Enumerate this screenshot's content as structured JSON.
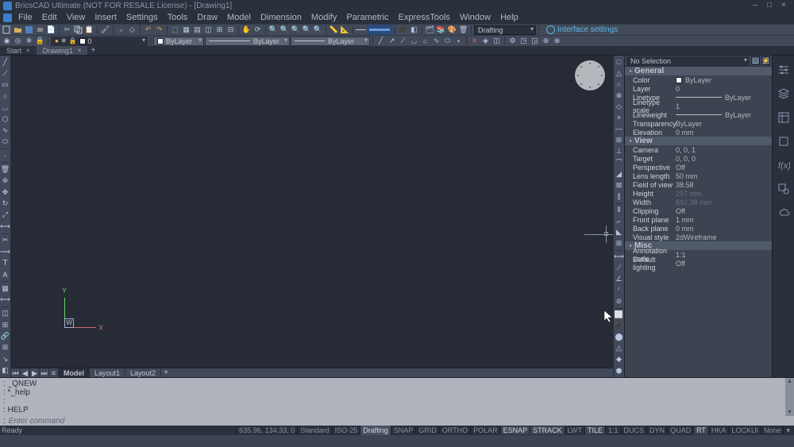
{
  "title": "BricsCAD Ultimate (NOT FOR RESALE License) - [Drawing1]",
  "menus": [
    "File",
    "Edit",
    "View",
    "Insert",
    "Settings",
    "Tools",
    "Draw",
    "Model",
    "Dimension",
    "Modify",
    "Parametric",
    "ExpressTools",
    "Window",
    "Help"
  ],
  "toolbar2": {
    "layer_value": "0",
    "workspace": "Drafting",
    "if_settings": "Interface settings",
    "bylayer": "ByLayer"
  },
  "tabs": {
    "start": "Start",
    "drawing": "Drawing1"
  },
  "ucs": {
    "w": "W",
    "x": "X",
    "y": "Y"
  },
  "layout_tabs": {
    "model": "Model",
    "l1": "Layout1",
    "l2": "Layout2"
  },
  "props": {
    "no_selection": "No Selection",
    "groups": {
      "general": "General",
      "view": "View",
      "misc": "Misc"
    },
    "general": {
      "color_k": "Color",
      "color_v": "ByLayer",
      "layer_k": "Layer",
      "layer_v": "0",
      "linetype_k": "Linetype",
      "linetype_v": "ByLayer",
      "linetype_scale_k": "Linetype scale",
      "linetype_scale_v": "1",
      "lineweight_k": "Lineweight",
      "lineweight_v": "ByLayer",
      "transparency_k": "Transparency",
      "transparency_v": "ByLayer",
      "elevation_k": "Elevation",
      "elevation_v": "0 mm"
    },
    "view": {
      "camera_k": "Camera",
      "camera_v": "0, 0, 1",
      "target_k": "Target",
      "target_v": "0, 0, 0",
      "perspective_k": "Perspective",
      "perspective_v": "Off",
      "lens_k": "Lens length",
      "lens_v": "50 mm",
      "fov_k": "Field of view",
      "fov_v": "38.58",
      "height_k": "Height",
      "height_v": "297 mm",
      "width_k": "Width",
      "width_v": "692.38 mm",
      "clipping_k": "Clipping",
      "clipping_v": "Off",
      "front_k": "Front plane",
      "front_v": "1 mm",
      "back_k": "Back plane",
      "back_v": "0 mm",
      "visual_k": "Visual style",
      "visual_v": "2dWireframe"
    },
    "misc": {
      "anno_k": "Annotation scale",
      "anno_v": "1:1",
      "light_k": "Default lighting",
      "light_v": "Off"
    }
  },
  "cmd_history": [
    ": _QNEW",
    ": *_help",
    ":",
    ": HELP"
  ],
  "cmd_prompt": ":",
  "cmd_hint": "Enter command",
  "status": {
    "ready": "Ready",
    "coords": "635.96, 134.33, 0",
    "std": "Standard",
    "iso": "ISO-25",
    "drafting": "Drafting",
    "items": [
      "SNAP",
      "GRID",
      "ORTHO",
      "POLAR",
      "ESNAP",
      "STRACK",
      "LWT",
      "TILE",
      "1:1",
      "DUCS",
      "DYN",
      "QUAD",
      "RT",
      "HKA",
      "LOCKUI"
    ],
    "on": {
      "ESNAP": true,
      "STRACK": true,
      "TILE": true,
      "RT": true
    },
    "none": "None"
  }
}
